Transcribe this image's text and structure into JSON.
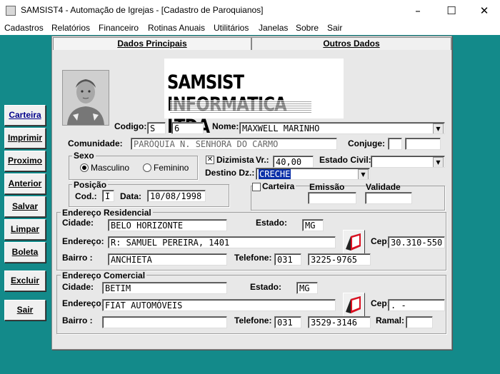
{
  "window": {
    "title": "SAMSIST4 - Automação de Igrejas - [Cadastro de Paroquianos]"
  },
  "menu": [
    "Cadastros",
    "Relatórios",
    "Financeiro",
    "Rotinas Anuais",
    "Utilitários",
    "Janelas",
    "Sobre",
    "Sair"
  ],
  "sidebar": [
    "Carteira",
    "Imprimir",
    "Proximo",
    "Anterior",
    "Salvar",
    "Limpar",
    "Boleta",
    "Excluir",
    "Sair"
  ],
  "tabs": [
    "Dados Principais",
    "Outros Dados"
  ],
  "logo": {
    "text": "SAMSIST INFORMATICA LTDA"
  },
  "form": {
    "codigo_label": "Codigo:",
    "codigo_a": "S",
    "codigo_b": "6",
    "nome_label": "Nome:",
    "nome": "MAXWELL MARINHO",
    "comunidade_label": "Comunidade:",
    "comunidade": "PARÓQUIA N. SENHORA DO CARMO",
    "conjuge_label": "Conjuge:",
    "conjuge": "",
    "sexo_label": "Sexo",
    "masculino": "Masculino",
    "feminino": "Feminino",
    "dizimista_label": "Dizimista",
    "vr_label": "Vr.:",
    "vr": "40,00",
    "estado_civil_label": "Estado Civil:",
    "estado_civil": "",
    "destino_label": "Destino Dz.:",
    "destino": "CRECHE",
    "posicao_label": "Posição",
    "cod_label": "Cod.:",
    "cod": "I",
    "data_label": "Data:",
    "data": "10/08/1998",
    "carteira_label": "Carteira",
    "emissao_label": "Emissão",
    "validade_label": "Validade"
  },
  "residencial": {
    "title": "Endereço Residencial",
    "cidade_label": "Cidade:",
    "cidade": "BELO HORIZONTE",
    "estado_label": "Estado:",
    "estado": "MG",
    "endereco_label": "Endereço:",
    "endereco": "R: SAMUEL PEREIRA, 1401",
    "cep_label": "Cep:",
    "cep": "30.310-550",
    "bairro_label": "Bairro  :",
    "bairro": "ANCHIETA",
    "telefone_label": "Telefone:",
    "ddd": "031",
    "telefone": "3225-9765"
  },
  "comercial": {
    "title": "Endereço Comercial",
    "cidade_label": "Cidade:",
    "cidade": "BETIM",
    "estado_label": "Estado:",
    "estado": "MG",
    "endereco_label": "Endereço:",
    "endereco": "FIAT AUTOMÓVEIS",
    "cep_label": "Cep:",
    "cep": ".   -",
    "bairro_label": "Bairro  :",
    "bairro": "",
    "telefone_label": "Telefone:",
    "ddd": "031",
    "telefone": "3529-3146",
    "ramal_label": "Ramal:",
    "ramal": ""
  }
}
